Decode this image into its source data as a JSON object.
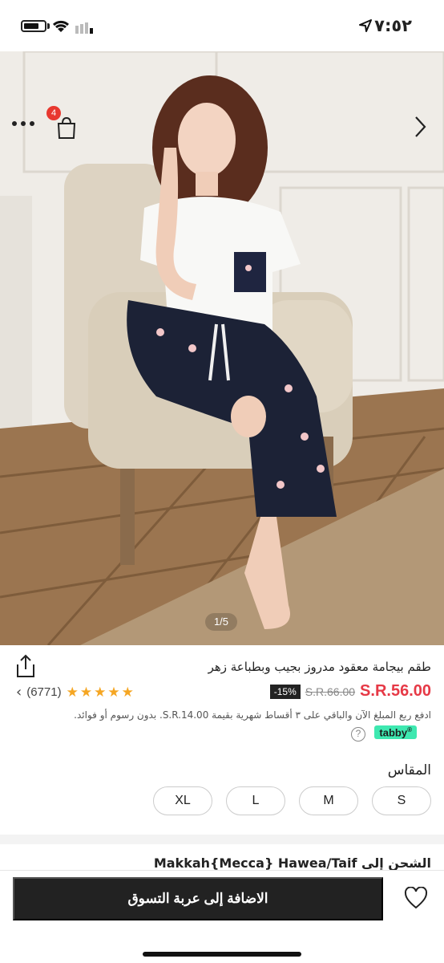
{
  "status_bar": {
    "time": "٧:٥٢",
    "icons": [
      "battery-icon",
      "wifi-icon",
      "signal-icon",
      "location-arrow-icon"
    ]
  },
  "gallery": {
    "cart_count": "4",
    "pager": "1/5",
    "icons": [
      "more-icon",
      "shopping-bag-icon",
      "chevron-right-icon"
    ]
  },
  "product": {
    "title": "طقم بيجامة معقود مدروز بجيب وبطباعة زهر",
    "price_current": "S.R.56.00",
    "price_old": "S.R.66.00",
    "discount": "-15%",
    "rating_count": "(6771)",
    "rating_stars": 5,
    "installment_text": "ادفع ربع المبلغ الآن والباقي على ٣ أقساط شهرية بقيمة S.R.14.00. بدون رسوم أو فوائد.",
    "tabby_label": "tabby",
    "size_label": "المقاس",
    "sizes": [
      "S",
      "M",
      "L",
      "XL"
    ],
    "shipping_text": "الشحن إلى Makkah{Mecca} Hawea/Taif"
  },
  "bottom_bar": {
    "add_to_cart_label": "الاضافة إلى عربة التسوق"
  },
  "colors": {
    "price_red": "#e63946",
    "star_gold": "#f5a623",
    "tabby_green": "#3ee8b0",
    "button_dark": "#222222"
  }
}
